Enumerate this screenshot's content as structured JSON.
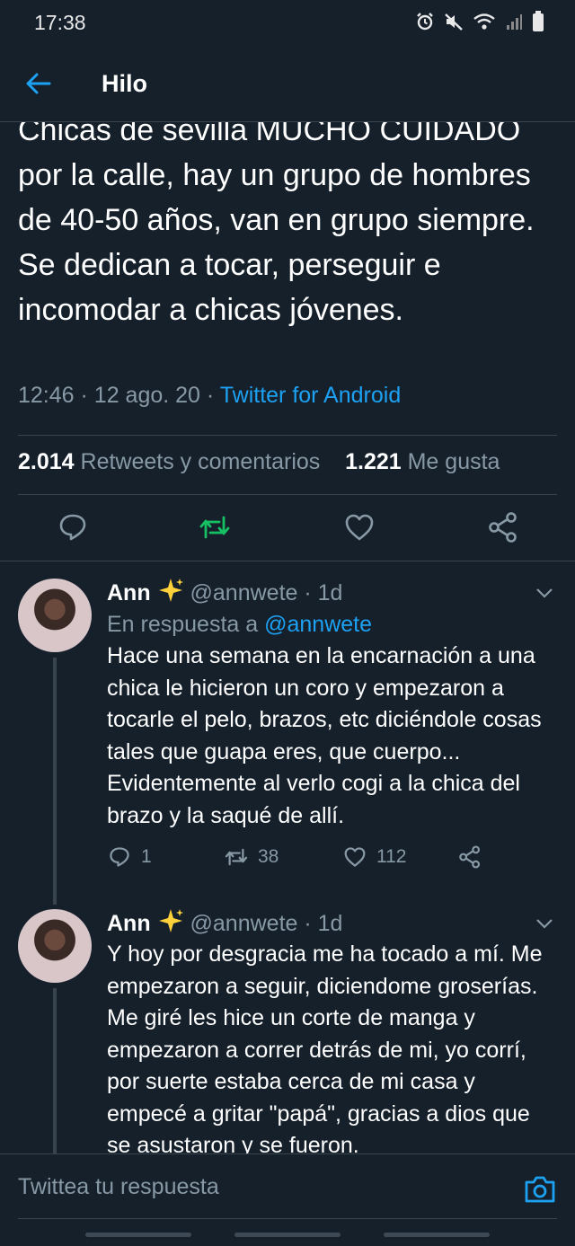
{
  "status_bar": {
    "time": "17:38",
    "icons": [
      "alarm-icon",
      "mute-icon",
      "wifi-icon",
      "signal-icon",
      "battery-icon"
    ]
  },
  "header": {
    "back_icon": "arrow-left-icon",
    "title": "Hilo"
  },
  "tweet": {
    "text": "Chicas de sevilla MUCHO CUIDADO por la calle, hay un grupo de hombres de 40-50 años, van en grupo siempre. Se dedican a tocar, perseguir e incomodar a chicas jóvenes.",
    "time": "12:46",
    "date": "12 ago. 20",
    "source": "Twitter for Android",
    "retweets_count": "2.014",
    "retweets_label": "Retweets y comentarios",
    "likes_count": "1.221",
    "likes_label": "Me gusta"
  },
  "replies": [
    {
      "name": "Ann",
      "handle": "@annwete",
      "age": "1d",
      "reply_to_label": "En respuesta a",
      "reply_to_handle": "@annwete",
      "text": "Hace una semana en la encarnación a una chica le hicieron un coro y empezaron a tocarle el pelo, brazos, etc diciéndole cosas tales que guapa eres, que cuerpo... Evidentemente al verlo cogi a la chica del brazo y la saqué de allí.",
      "replies": "1",
      "retweets": "38",
      "likes": "112"
    },
    {
      "name": "Ann",
      "handle": "@annwete",
      "age": "1d",
      "text": "Y hoy por desgracia me ha tocado a mí. Me empezaron a seguir, diciendome groserías. Me giré les hice un corte de manga y empezaron a correr detrás de mi, yo corrí, por suerte estaba cerca de mi casa y empecé a gritar \"papá\", gracias a dios que se asustaron y se fueron."
    }
  ],
  "compose": {
    "placeholder": "Twittea tu respuesta"
  },
  "colors": {
    "background": "#15202b",
    "accent": "#1da1f2",
    "retweet": "#17bf63",
    "secondary_text": "#8899a6",
    "divider": "#38444d"
  }
}
